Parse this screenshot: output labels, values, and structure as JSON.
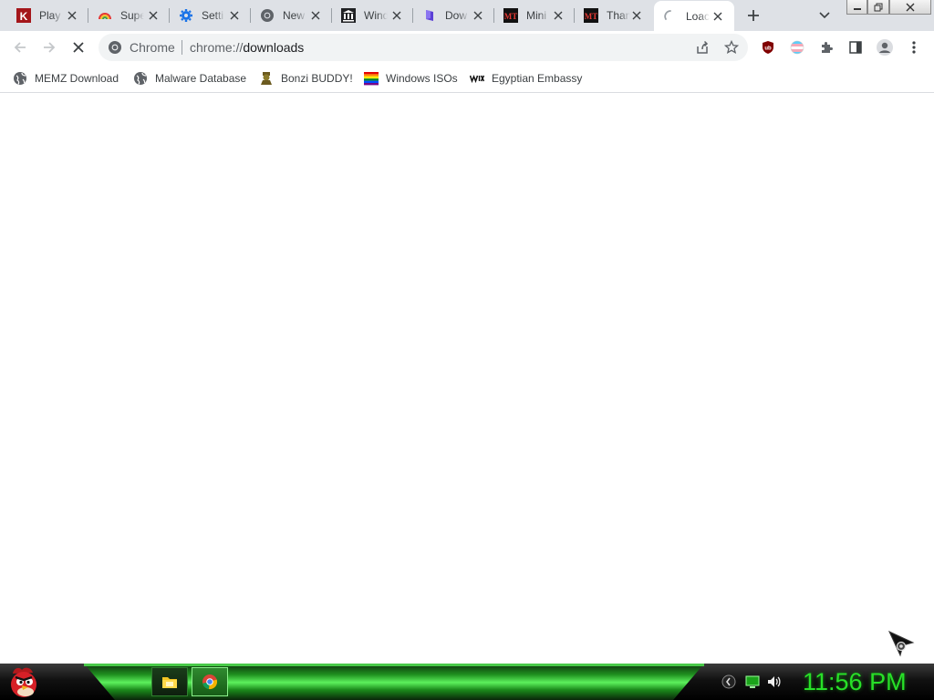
{
  "browser": {
    "tabs": [
      {
        "title": "Play",
        "favicon": "kahoot-k-icon",
        "active": false
      },
      {
        "title": "Supe",
        "favicon": "rainbow-icon",
        "active": false
      },
      {
        "title": "Setti",
        "favicon": "settings-gear-icon",
        "active": false
      },
      {
        "title": "New",
        "favicon": "chrome-icon",
        "active": false
      },
      {
        "title": "Wind",
        "favicon": "archive-building-icon",
        "active": false
      },
      {
        "title": "Dow",
        "favicon": "purple-app-icon",
        "active": false
      },
      {
        "title": "Mini",
        "favicon": "mt-icon",
        "active": false
      },
      {
        "title": "Than",
        "favicon": "mt-icon",
        "active": false
      },
      {
        "title": "Loac",
        "favicon": "loading-spinner-icon",
        "active": true
      }
    ],
    "omnibox": {
      "site_label": "Chrome",
      "url_scheme": "chrome://",
      "url_host": "downloads"
    },
    "bookmarks": [
      {
        "label": "MEMZ Download",
        "icon": "globe-icon"
      },
      {
        "label": "Malware Database",
        "icon": "globe-icon"
      },
      {
        "label": "Bonzi BUDDY!",
        "icon": "bonzi-icon"
      },
      {
        "label": "Windows ISOs",
        "icon": "rainbow-flag-icon"
      },
      {
        "label": "Egyptian Embassy",
        "icon": "wix-icon"
      }
    ],
    "extensions": [
      "ublock-origin-icon",
      "trans-flag-icon",
      "puzzle-icon",
      "side-panel-icon",
      "profile-icon",
      "menu-icon"
    ]
  },
  "taskbar": {
    "clock": "11:56 PM",
    "apps": [
      "file-explorer-icon",
      "chrome-icon"
    ],
    "tray": [
      "keyboard-icon",
      "network-icon",
      "volume-icon"
    ]
  },
  "colors": {
    "tabstrip_bg": "#dee1e6",
    "omnibox_bg": "#f1f3f4",
    "taskbar_accent": "#28e028",
    "clock_color": "#28e028"
  }
}
